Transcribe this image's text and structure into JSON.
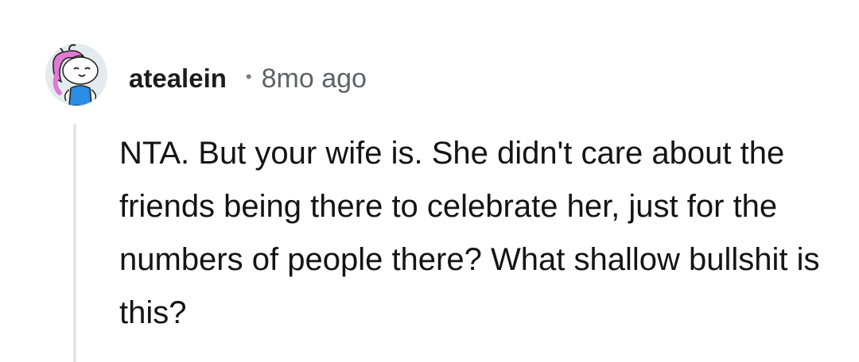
{
  "comment": {
    "username": "atealein",
    "separator": "•",
    "timestamp": "8mo ago",
    "body": "NTA. But your wife is. She didn't care about the friends being there to celebrate her, just for the numbers of people there? What shallow bullshit is this?",
    "avatar_icon": "snoo-avatar-icon"
  },
  "colors": {
    "background": "#ffffff",
    "username": "#1c1c1c",
    "timestamp": "#5d6468",
    "body_text": "#141414",
    "thread_line": "#e6e6e6",
    "avatar_bg": "#e4ebee",
    "avatar_hair": "#e07ad3",
    "avatar_shirt": "#2a8ee6"
  }
}
